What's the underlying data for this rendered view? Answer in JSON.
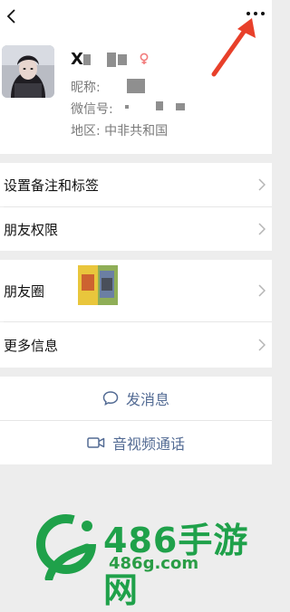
{
  "profile": {
    "nickname": "X",
    "remark_label": "昵称:",
    "wechat_id_label": "微信号:",
    "region": "地区:  中非共和国"
  },
  "list": {
    "tags": "设置备注和标签",
    "friend_permissions": "朋友权限",
    "moments": "朋友圈",
    "more_info": "更多信息"
  },
  "actions": {
    "send_message": "发消息",
    "video_call": "音视频通话"
  },
  "watermark": {
    "title": "486手游网",
    "url": "486g.com"
  }
}
